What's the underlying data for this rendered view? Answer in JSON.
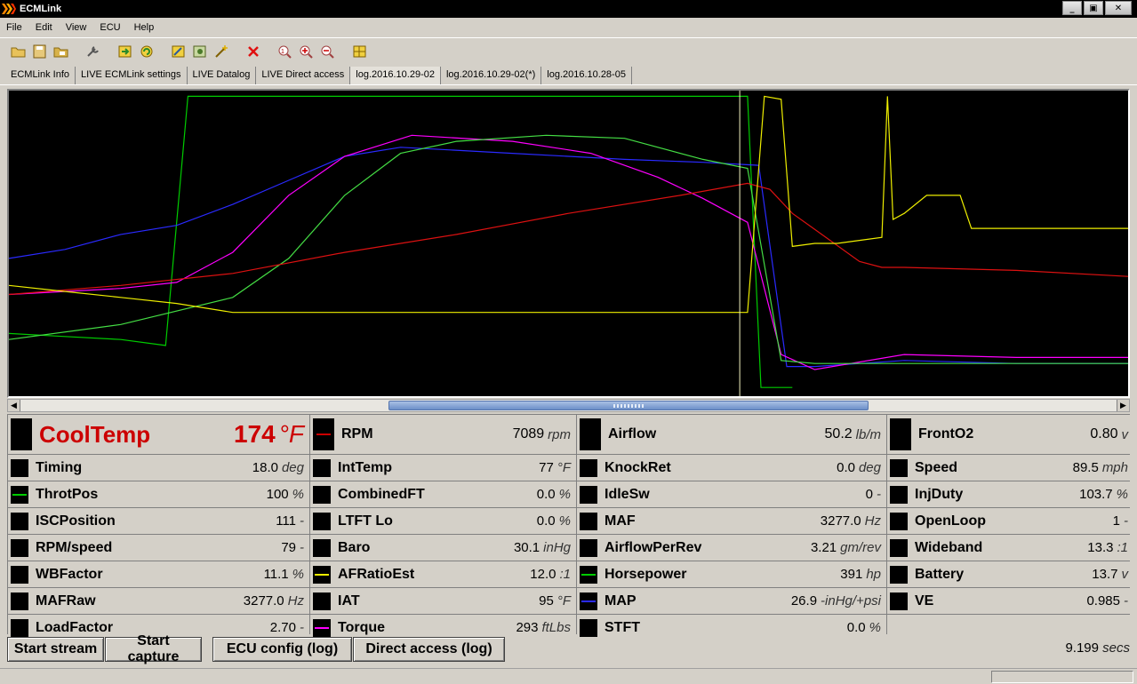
{
  "window": {
    "title": "ECMLink",
    "minimize": "_",
    "maximize": "▣",
    "close": "✕"
  },
  "menu": [
    "File",
    "Edit",
    "View",
    "ECU",
    "Help"
  ],
  "toolbar": {
    "icons": [
      "open-folder-icon",
      "save-icon",
      "open-log-icon",
      "tools-icon",
      "load-icon",
      "refresh-icon",
      "edit-icon",
      "config-icon",
      "wand-icon",
      "delete-icon",
      "zoom-reset-icon",
      "zoom-in-icon",
      "zoom-out-icon",
      "grid-icon"
    ]
  },
  "tabs": [
    {
      "label": "ECMLink Info",
      "active": false
    },
    {
      "label": "LIVE ECMLink settings",
      "active": false
    },
    {
      "label": "LIVE Datalog",
      "active": false
    },
    {
      "label": "LIVE Direct access",
      "active": false
    },
    {
      "label": "log.2016.10.29-02",
      "active": true
    },
    {
      "label": "log.2016.10.29-02(*)",
      "active": false
    },
    {
      "label": "log.2016.10.28-05",
      "active": false
    }
  ],
  "chart_data": {
    "type": "line",
    "title": "",
    "xlabel": "",
    "ylabel": "",
    "normalized": true,
    "ylim": [
      0,
      1
    ],
    "series": [
      {
        "color": "#00cc00",
        "values": [
          [
            0,
            0.2
          ],
          [
            0.05,
            0.19
          ],
          [
            0.1,
            0.18
          ],
          [
            0.14,
            0.16
          ],
          [
            0.147,
            0.45
          ],
          [
            0.16,
            0.99
          ],
          [
            0.66,
            0.99
          ],
          [
            0.672,
            0.02
          ],
          [
            0.7,
            0.02
          ]
        ]
      },
      {
        "color": "#2a2aff",
        "values": [
          [
            0,
            0.45
          ],
          [
            0.05,
            0.48
          ],
          [
            0.1,
            0.53
          ],
          [
            0.15,
            0.56
          ],
          [
            0.2,
            0.63
          ],
          [
            0.25,
            0.71
          ],
          [
            0.3,
            0.79
          ],
          [
            0.35,
            0.82
          ],
          [
            0.45,
            0.8
          ],
          [
            0.55,
            0.78
          ],
          [
            0.62,
            0.77
          ],
          [
            0.67,
            0.76
          ],
          [
            0.695,
            0.09
          ],
          [
            0.72,
            0.09
          ],
          [
            0.8,
            0.11
          ],
          [
            0.9,
            0.1
          ],
          [
            1.0,
            0.1
          ]
        ]
      },
      {
        "color": "#ff00ff",
        "values": [
          [
            0,
            0.33
          ],
          [
            0.05,
            0.34
          ],
          [
            0.1,
            0.35
          ],
          [
            0.15,
            0.37
          ],
          [
            0.2,
            0.47
          ],
          [
            0.25,
            0.66
          ],
          [
            0.3,
            0.79
          ],
          [
            0.36,
            0.86
          ],
          [
            0.45,
            0.84
          ],
          [
            0.52,
            0.8
          ],
          [
            0.58,
            0.72
          ],
          [
            0.62,
            0.65
          ],
          [
            0.66,
            0.57
          ],
          [
            0.69,
            0.13
          ],
          [
            0.72,
            0.08
          ],
          [
            0.8,
            0.13
          ],
          [
            0.9,
            0.12
          ],
          [
            1.0,
            0.12
          ]
        ]
      },
      {
        "color": "#44dd44",
        "values": [
          [
            0,
            0.18
          ],
          [
            0.1,
            0.23
          ],
          [
            0.2,
            0.32
          ],
          [
            0.25,
            0.45
          ],
          [
            0.3,
            0.66
          ],
          [
            0.35,
            0.8
          ],
          [
            0.4,
            0.84
          ],
          [
            0.48,
            0.86
          ],
          [
            0.55,
            0.85
          ],
          [
            0.62,
            0.78
          ],
          [
            0.66,
            0.75
          ],
          [
            0.69,
            0.11
          ],
          [
            0.72,
            0.1
          ],
          [
            0.8,
            0.1
          ],
          [
            0.9,
            0.1
          ],
          [
            1.0,
            0.1
          ]
        ]
      },
      {
        "color": "#dd1111",
        "values": [
          [
            0,
            0.33
          ],
          [
            0.1,
            0.36
          ],
          [
            0.2,
            0.4
          ],
          [
            0.3,
            0.47
          ],
          [
            0.4,
            0.53
          ],
          [
            0.5,
            0.6
          ],
          [
            0.6,
            0.66
          ],
          [
            0.66,
            0.7
          ],
          [
            0.68,
            0.68
          ],
          [
            0.7,
            0.6
          ],
          [
            0.73,
            0.52
          ],
          [
            0.76,
            0.44
          ],
          [
            0.78,
            0.42
          ],
          [
            0.8,
            0.42
          ],
          [
            0.9,
            0.41
          ],
          [
            1.0,
            0.39
          ]
        ]
      },
      {
        "color": "#eeee00",
        "values": [
          [
            0,
            0.36
          ],
          [
            0.05,
            0.34
          ],
          [
            0.1,
            0.32
          ],
          [
            0.15,
            0.3
          ],
          [
            0.2,
            0.27
          ],
          [
            0.66,
            0.27
          ],
          [
            0.675,
            0.99
          ],
          [
            0.69,
            0.98
          ],
          [
            0.7,
            0.49
          ],
          [
            0.72,
            0.5
          ],
          [
            0.74,
            0.5
          ],
          [
            0.76,
            0.51
          ],
          [
            0.78,
            0.52
          ],
          [
            0.785,
            0.99
          ],
          [
            0.79,
            0.58
          ],
          [
            0.8,
            0.6
          ],
          [
            0.82,
            0.66
          ],
          [
            0.85,
            0.66
          ],
          [
            0.86,
            0.55
          ],
          [
            1.0,
            0.55
          ]
        ]
      }
    ],
    "cursor_x": 0.653
  },
  "gauges": [
    {
      "name": "CoolTemp",
      "value": "174",
      "unit": "°F",
      "color": "",
      "big": true
    },
    {
      "name": "RPM",
      "value": "7089",
      "unit": "rpm",
      "color": "#cc0000",
      "big": true
    },
    {
      "name": "Airflow",
      "value": "50.2",
      "unit": "lb/m",
      "color": "",
      "big": true
    },
    {
      "name": "FrontO2",
      "value": "0.80",
      "unit": "v",
      "color": "",
      "big": true
    },
    {
      "name": "Timing",
      "value": "18.0",
      "unit": "deg",
      "color": ""
    },
    {
      "name": "IntTemp",
      "value": "77",
      "unit": "°F",
      "color": ""
    },
    {
      "name": "KnockRet",
      "value": "0.0",
      "unit": "deg",
      "color": ""
    },
    {
      "name": "Speed",
      "value": "89.5",
      "unit": "mph",
      "color": ""
    },
    {
      "name": "ThrotPos",
      "value": "100",
      "unit": "%",
      "color": "#00cc00"
    },
    {
      "name": "CombinedFT",
      "value": "0.0",
      "unit": "%",
      "color": ""
    },
    {
      "name": "IdleSw",
      "value": "0",
      "unit": "-",
      "color": ""
    },
    {
      "name": "InjDuty",
      "value": "103.7",
      "unit": "%",
      "color": ""
    },
    {
      "name": "ISCPosition",
      "value": "111",
      "unit": "-",
      "color": ""
    },
    {
      "name": "LTFT Lo",
      "value": "0.0",
      "unit": "%",
      "color": ""
    },
    {
      "name": "MAF",
      "value": "3277.0",
      "unit": "Hz",
      "color": ""
    },
    {
      "name": "OpenLoop",
      "value": "1",
      "unit": "-",
      "color": ""
    },
    {
      "name": "RPM/speed",
      "value": "79",
      "unit": "-",
      "color": ""
    },
    {
      "name": "Baro",
      "value": "30.1",
      "unit": "inHg",
      "color": ""
    },
    {
      "name": "AirflowPerRev",
      "value": "3.21",
      "unit": "gm/rev",
      "color": ""
    },
    {
      "name": "Wideband",
      "value": "13.3",
      "unit": ":1",
      "color": ""
    },
    {
      "name": "WBFactor",
      "value": "11.1",
      "unit": "%",
      "color": ""
    },
    {
      "name": "AFRatioEst",
      "value": "12.0",
      "unit": ":1",
      "color": "#eeee00"
    },
    {
      "name": "Horsepower",
      "value": "391",
      "unit": "hp",
      "color": "#00cc00"
    },
    {
      "name": "Battery",
      "value": "13.7",
      "unit": "v",
      "color": ""
    },
    {
      "name": "MAFRaw",
      "value": "3277.0",
      "unit": "Hz",
      "color": ""
    },
    {
      "name": "IAT",
      "value": "95",
      "unit": "°F",
      "color": ""
    },
    {
      "name": "MAP",
      "value": "26.9",
      "unit": "-inHg/+psi",
      "color": "#2a2aff"
    },
    {
      "name": "VE",
      "value": "0.985",
      "unit": "-",
      "color": ""
    },
    {
      "name": "LoadFactor",
      "value": "2.70",
      "unit": "-",
      "color": ""
    },
    {
      "name": "Torque",
      "value": "293",
      "unit": "ftLbs",
      "color": "#ff00ff"
    },
    {
      "name": "STFT",
      "value": "0.0",
      "unit": "%",
      "color": ""
    },
    {
      "name": "",
      "value": "",
      "unit": "",
      "color": "",
      "empty": true
    }
  ],
  "buttons": {
    "start_stream": "Start stream",
    "start_capture": "Start capture",
    "ecu_config": "ECU config (log)",
    "direct_access": "Direct access (log)"
  },
  "elapsed": {
    "value": "9.199",
    "unit": "secs"
  }
}
